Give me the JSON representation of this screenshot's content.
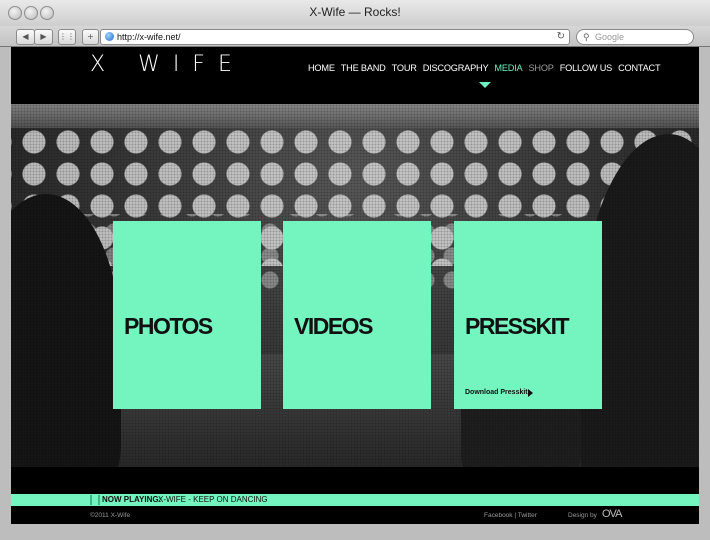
{
  "browser": {
    "title": "X-Wife — Rocks!",
    "url": "http://x-wife.net/",
    "search_placeholder": "Google",
    "back": "◀",
    "forward": "▶",
    "add": "+",
    "reload": "↻"
  },
  "site": {
    "logo": "X WIFE",
    "nav": [
      "HOME",
      "THE BAND",
      "TOUR",
      "DISCOGRAPHY",
      "MEDIA",
      "SHOP",
      "FOLLOW US",
      "CONTACT"
    ],
    "active_nav": "MEDIA",
    "tiles": {
      "photos": "PHOTOS",
      "videos": "VIDEOS",
      "presskit": "PRESSKIT",
      "download": "Download Presskit"
    },
    "now_playing_label": "NOW PLAYING:",
    "now_playing_song": "X-WIFE - KEEP ON DANCING",
    "footer": {
      "copyright": "©2011 X-Wife",
      "links": "Facebook | Twitter",
      "design_by": "Design by",
      "designer_logo": "OVA"
    }
  },
  "colors": {
    "accent": "#74f4bf",
    "background": "#000000"
  }
}
